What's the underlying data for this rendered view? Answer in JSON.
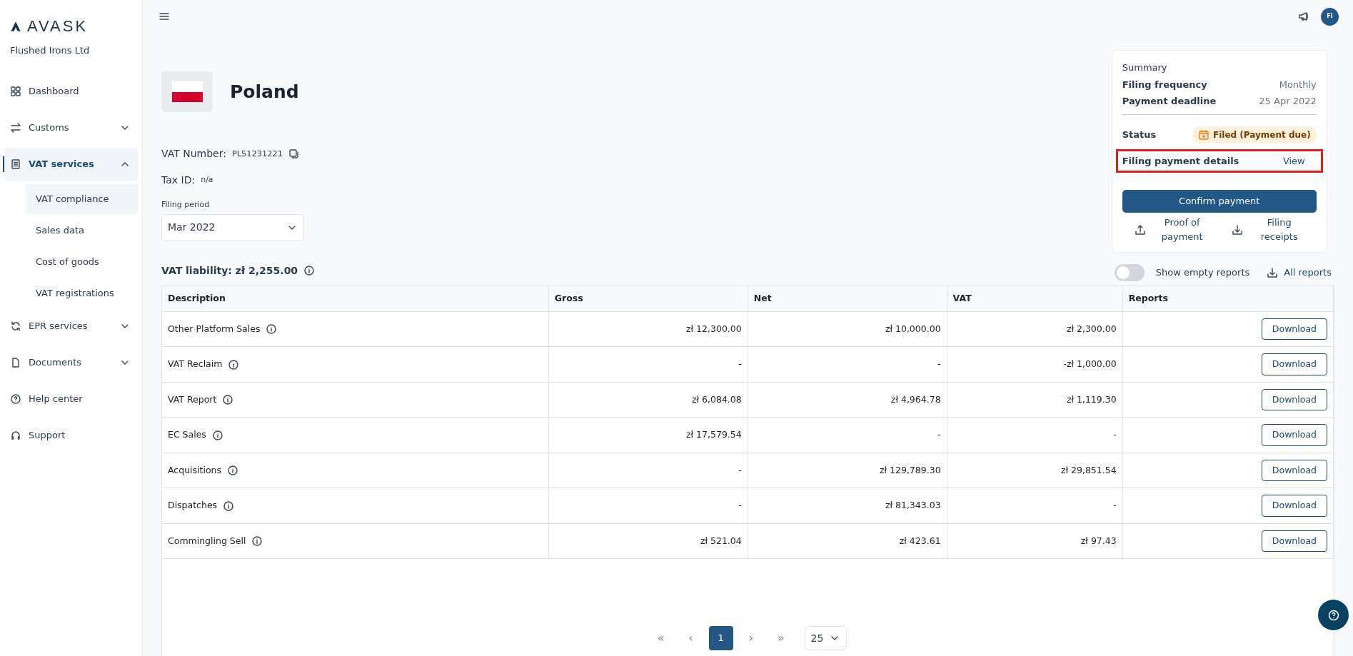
{
  "sidebar": {
    "logo": "AVASK",
    "company": "Flushed Irons Ltd",
    "items": [
      {
        "label": "Dashboard",
        "selected": false
      },
      {
        "label": "Customs",
        "expanded": false,
        "selected": false
      },
      {
        "label": "VAT services",
        "expanded": true,
        "selected": true,
        "children": [
          {
            "label": "VAT compliance",
            "selected": true
          },
          {
            "label": "Sales data",
            "selected": false
          },
          {
            "label": "Cost of goods",
            "selected": false
          },
          {
            "label": "VAT registrations",
            "selected": false
          }
        ]
      },
      {
        "label": "EPR services",
        "expanded": false,
        "selected": false
      },
      {
        "label": "Documents",
        "expanded": false,
        "selected": false
      },
      {
        "label": "Help center",
        "selected": false
      },
      {
        "label": "Support",
        "selected": false
      }
    ]
  },
  "topbar": {
    "avatar": "FI"
  },
  "country": {
    "name": "Poland",
    "vat_number_label": "VAT Number:",
    "vat_number": "PL51231221",
    "tax_id_label": "Tax ID:",
    "tax_id": "n/a"
  },
  "filing_period": {
    "label": "Filing period",
    "value": "Mar 2022"
  },
  "liability": "VAT liability: zł 2,255.00",
  "show_empty_reports": {
    "label": "Show empty reports",
    "on": false
  },
  "all_reports": "All reports",
  "summary": {
    "title": "Summary",
    "rows": [
      {
        "label": "Filing frequency",
        "value": "Monthly"
      },
      {
        "label": "Payment deadline",
        "value": "25 Apr 2022"
      }
    ],
    "status_label": "Status",
    "status": "Filed (Payment due)",
    "details_label": "Filing payment details",
    "details_link": "View",
    "details_highlighted": true,
    "confirm": "Confirm payment",
    "proof": "Proof of payment",
    "receipts": "Filing receipts"
  },
  "table": {
    "columns": [
      "Description",
      "Gross",
      "Net",
      "VAT",
      "Reports"
    ],
    "rows": [
      {
        "description": "Other Platform Sales",
        "gross": "zł 12,300.00",
        "net": "zł 10,000.00",
        "vat": "zł 2,300.00",
        "action": "Download"
      },
      {
        "description": "VAT Reclaim",
        "gross": "-",
        "net": "-",
        "vat": "-zł 1,000.00",
        "action": "Download"
      },
      {
        "description": "VAT Report",
        "gross": "zł 6,084.08",
        "net": "zł 4,964.78",
        "vat": "zł 1,119.30",
        "action": "Download"
      },
      {
        "description": "EC Sales",
        "gross": "zł 17,579.54",
        "net": "-",
        "vat": "-",
        "action": "Download"
      },
      {
        "description": "Acquisitions",
        "gross": "-",
        "net": "zł 129,789.30",
        "vat": "zł 29,851.54",
        "action": "Download"
      },
      {
        "description": "Dispatches",
        "gross": "-",
        "net": "zł 81,343.03",
        "vat": "-",
        "action": "Download"
      },
      {
        "description": "Commingling Sell",
        "gross": "zł 521.04",
        "net": "zł 423.61",
        "vat": "zł 97.43",
        "action": "Download"
      }
    ]
  },
  "pagination": {
    "first": "«",
    "prev": "‹",
    "pages": [
      {
        "label": "1",
        "selected": true
      }
    ],
    "next": "›",
    "last": "»",
    "page_size": "25"
  }
}
